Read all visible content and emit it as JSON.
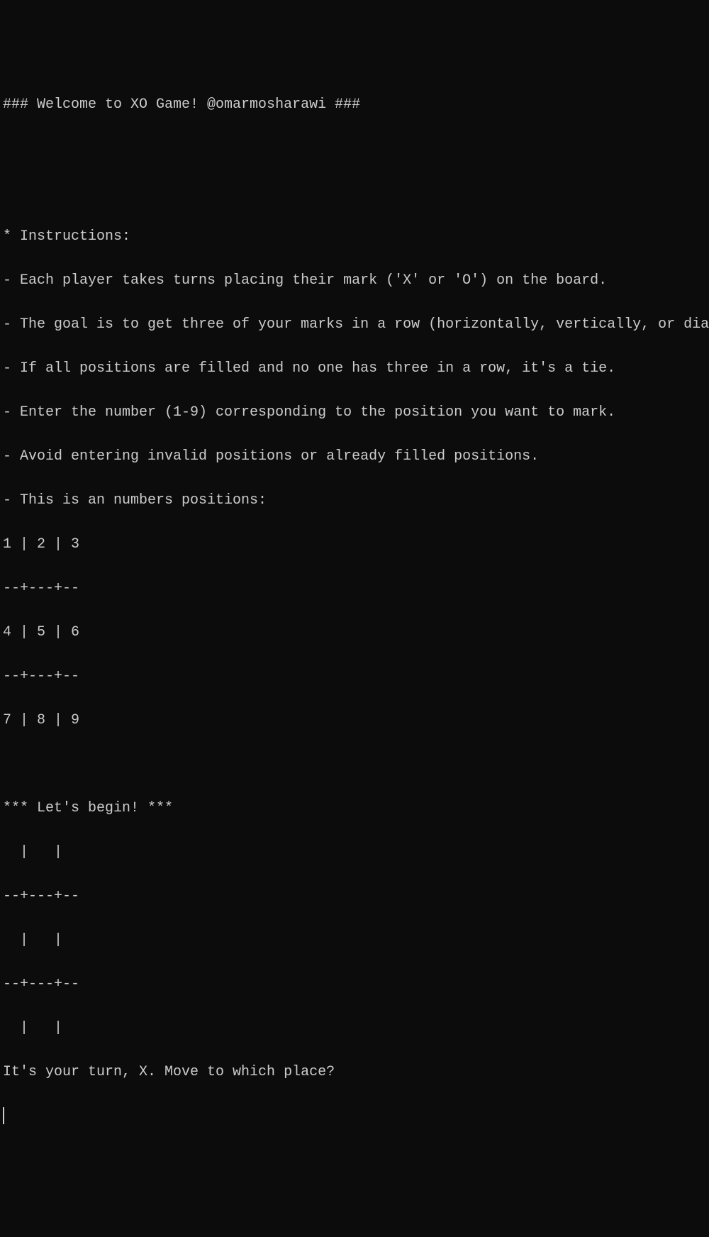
{
  "terminal": {
    "welcome": "### Welcome to XO Game! @omarmosharawi ###",
    "blank1": "",
    "blank2": "",
    "instructions_header": "* Instructions:",
    "instr1": "- Each player takes turns placing their mark ('X' or 'O') on the board.",
    "instr2": "- The goal is to get three of your marks in a row (horizontally, vertically, or diagonally).",
    "instr3": "- If all positions are filled and no one has three in a row, it's a tie.",
    "instr4": "- Enter the number (1-9) corresponding to the position you want to mark.",
    "instr5": "- Avoid entering invalid positions or already filled positions.",
    "instr6": "- This is an numbers positions:",
    "posrow1": "1 | 2 | 3",
    "possep1": "--+---+--",
    "posrow2": "4 | 5 | 6",
    "possep2": "--+---+--",
    "posrow3": "7 | 8 | 9",
    "blank3": "",
    "begin": "*** Let's begin! ***",
    "boardrow1": "  |   |",
    "boardsep1": "--+---+--",
    "boardrow2": "  |   |",
    "boardsep2": "--+---+--",
    "boardrow3": "  |   |",
    "prompt": "It's your turn, X. Move to which place?"
  }
}
